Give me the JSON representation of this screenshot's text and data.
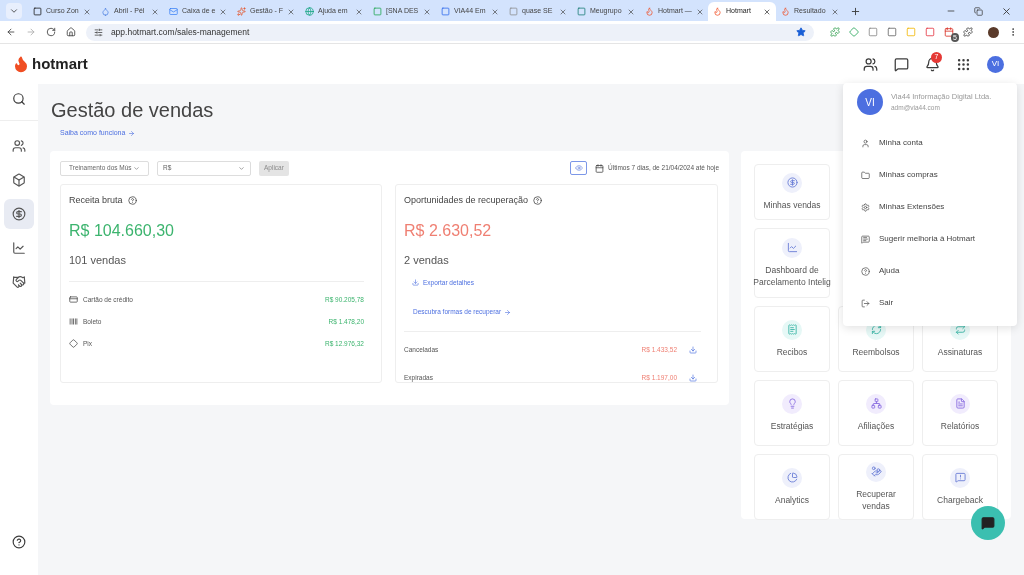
{
  "browser": {
    "tabs": [
      {
        "title": "Curso Zon",
        "selected": false
      },
      {
        "title": "Abril - Pél",
        "selected": false
      },
      {
        "title": "Caixa de e",
        "selected": false
      },
      {
        "title": "Gestão - F",
        "selected": false
      },
      {
        "title": "Ajuda em",
        "selected": false
      },
      {
        "title": "[SNA DES",
        "selected": false
      },
      {
        "title": "VIA44 Em",
        "selected": false
      },
      {
        "title": "quase SE",
        "selected": false
      },
      {
        "title": "Meugrupo",
        "selected": false
      },
      {
        "title": "Hotmart —",
        "selected": false
      },
      {
        "title": "Hotmart",
        "selected": true
      },
      {
        "title": "Resultado",
        "selected": false
      }
    ],
    "url": "app.hotmart.com/sales-management",
    "extension_badge": "5"
  },
  "header": {
    "logo": "hotmart",
    "notification_count": "7",
    "avatar": "VI"
  },
  "sidebar": {
    "items": [
      {
        "selected": false
      },
      {
        "selected": false
      },
      {
        "selected": true
      },
      {
        "selected": false
      },
      {
        "selected": false
      }
    ]
  },
  "page": {
    "title": "Gestão de vendas",
    "help_link": "Saiba como funciona",
    "filters": {
      "product": "Treinamento dos Mús",
      "currency": "R$",
      "apply": "Aplicar",
      "date_range": "Últimos 7 dias, de 21/04/2024 até hoje"
    },
    "revenue": {
      "title": "Receita bruta",
      "amount": "R$ 104.660,30",
      "sales": "101 vendas",
      "methods": [
        {
          "kind": "card",
          "label": "Cartão de crédito",
          "value": "R$ 90.205,78"
        },
        {
          "kind": "barcode",
          "label": "Boleto",
          "value": "R$ 1.478,20"
        },
        {
          "kind": "pix",
          "label": "Pix",
          "value": "R$ 12.976,32"
        }
      ]
    },
    "recovery": {
      "title": "Oportunidades de recuperação",
      "amount": "R$ 2.630,52",
      "sales": "2 vendas",
      "export": "Exportar detalhes",
      "discover": "Descubra formas de recuperar",
      "rows": [
        {
          "label": "Canceladas",
          "value": "R$ 1.433,52"
        },
        {
          "label": "Expiradas",
          "value": "R$ 1.197,00"
        }
      ]
    }
  },
  "tiles": [
    {
      "lines": [
        "Minhas vendas"
      ]
    },
    {
      "lines": [
        "Dashboard de",
        "Parcelamento Intelig"
      ]
    },
    {
      "lines": [
        "Recibos"
      ]
    },
    {
      "lines": [
        "Reembolsos"
      ]
    },
    {
      "lines": [
        "Assinaturas"
      ]
    },
    {
      "lines": [
        "Estratégias"
      ]
    },
    {
      "lines": [
        "Afiliações"
      ]
    },
    {
      "lines": [
        "Relatórios"
      ]
    },
    {
      "lines": [
        "Analytics"
      ]
    },
    {
      "lines": [
        "Recuperar",
        "vendas"
      ]
    },
    {
      "lines": [
        "Chargeback"
      ]
    }
  ],
  "account_menu": {
    "avatar": "VI",
    "name": "Via44 Informação Digital Ltda.",
    "email": "adm@via44.com",
    "items": [
      "Minha conta",
      "Minhas compras",
      "Minhas Extensões",
      "Sugerir melhoria à Hotmart",
      "Ajuda",
      "Sair"
    ]
  }
}
